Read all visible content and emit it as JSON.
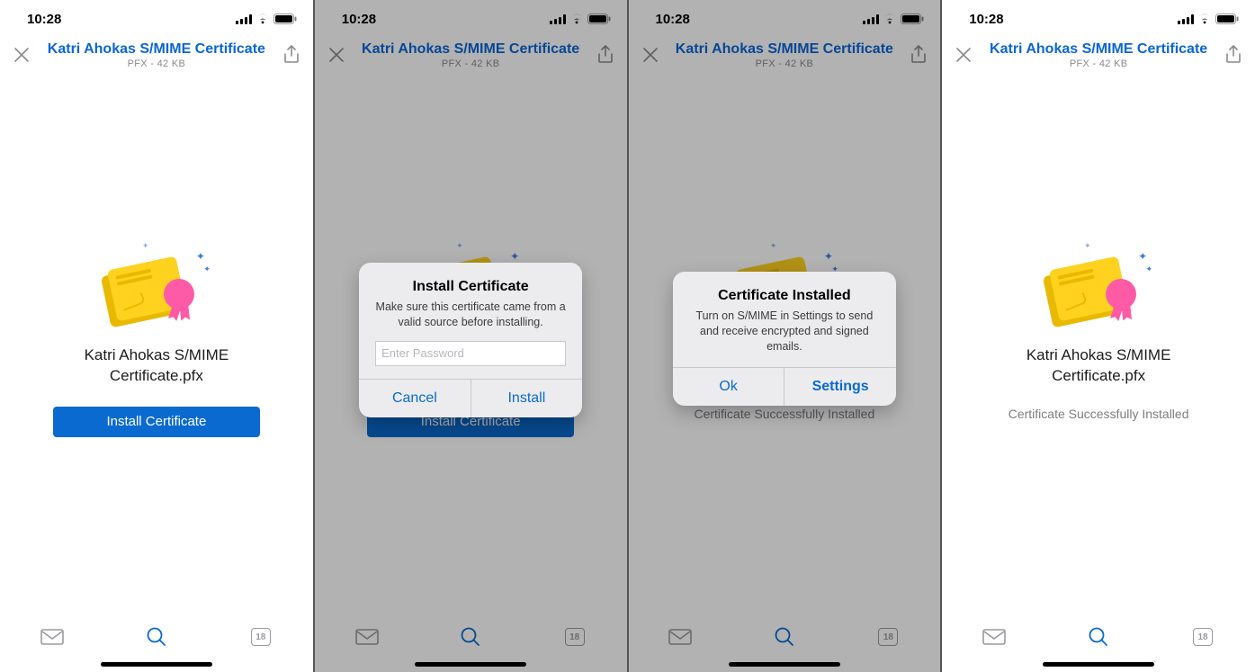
{
  "status": {
    "time": "10:28"
  },
  "header": {
    "title": "Katri Ahokas S/MIME Certificate",
    "subtitle": "PFX - 42 KB"
  },
  "file": {
    "name_line1": "Katri Ahokas S/MIME",
    "name_line2": "Certificate.pfx"
  },
  "buttons": {
    "install": "Install Certificate"
  },
  "status_text": {
    "success": "Certificate Successfully Installed"
  },
  "alert_install": {
    "title": "Install Certificate",
    "message": "Make sure this certificate came from a valid source before installing.",
    "placeholder": "Enter Password",
    "cancel": "Cancel",
    "confirm": "Install"
  },
  "alert_done": {
    "title": "Certificate Installed",
    "message": "Turn on S/MIME in Settings to send and receive encrypted and signed emails.",
    "ok": "Ok",
    "settings": "Settings"
  },
  "tabbar": {
    "calendar_day": "18"
  }
}
